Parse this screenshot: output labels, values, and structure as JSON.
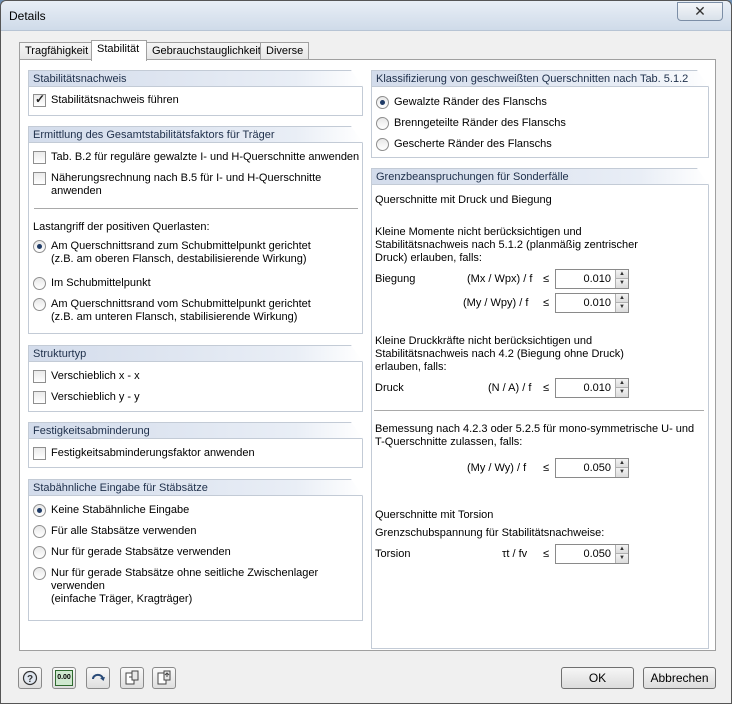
{
  "window": {
    "title": "Details",
    "close_glyph": "✕"
  },
  "tabs": [
    {
      "label": "Tragfähigkeit"
    },
    {
      "label": "Stabilität"
    },
    {
      "label": "Gebrauchstauglichkeit"
    },
    {
      "label": "Diverse"
    }
  ],
  "left": {
    "stab_nachweis": {
      "title": "Stabilitätsnachweis",
      "checkbox_label": "Stabilitätsnachweis führen",
      "checked": true
    },
    "ermittlung": {
      "title": "Ermittlung des Gesamtstabilitätsfaktors für Träger",
      "opt1": "Tab. B.2 für reguläre gewalzte I- und H-Querschnitte anwenden",
      "opt2_line1": "Näherungsrechnung nach B.5  für I- und H-Querschnitte",
      "opt2_line2": "anwenden",
      "lastangriff_label": "Lastangriff der positiven Querlasten:",
      "radio1_line1": "Am Querschnittsrand zum Schubmittelpunkt gerichtet",
      "radio1_line2": "(z.B. am oberen Flansch, destabilisierende Wirkung)",
      "radio2": "Im Schubmittelpunkt",
      "radio3_line1": "Am Querschnittsrand vom Schubmittelpunkt gerichtet",
      "radio3_line2": "(z.B. am unteren Flansch, stabilisierende Wirkung)"
    },
    "strukturtyp": {
      "title": "Strukturtyp",
      "opt1": "Verschieblich x - x",
      "opt2": "Verschieblich y - y"
    },
    "festigkeit": {
      "title": "Festigkeitsabminderung",
      "opt1": "Festigkeitsabminderungsfaktor anwenden"
    },
    "stabsatz": {
      "title": "Stabähnliche Eingabe für Stäbsätze",
      "r1": "Keine Stabähnliche Eingabe",
      "r2": "Für alle Stabsätze verwenden",
      "r3": "Nur für gerade Stabsätze verwenden",
      "r4_line1": "Nur für gerade Stabsätze ohne seitliche Zwischenlager verwenden",
      "r4_line2": "(einfache Träger, Kragträger)"
    }
  },
  "right": {
    "klass": {
      "title": "Klassifizierung von geschweißten Querschnitten nach Tab. 5.1.2",
      "r1": "Gewalzte Ränder des Flanschs",
      "r2": "Brenngeteilte Ränder des Flanschs",
      "r3": "Gescherte Ränder des Flanschs"
    },
    "grenz": {
      "title": "Grenzbeanspruchungen für Sonderfälle",
      "sub1": "Querschnitte mit Druck und Biegung",
      "p1_l1": "Kleine Momente nicht berücksichtigen und",
      "p1_l2": "Stabilitätsnachweis nach 5.1.2 (planmäßig zentrischer",
      "p1_l3": "Druck) erlauben, falls:",
      "biegung_label": "Biegung",
      "f1": "(Mx / Wpx) / f",
      "f2": "(My / Wpy) / f",
      "v1": "0.010",
      "v2": "0.010",
      "p2_l1": "Kleine Druckkräfte nicht berücksichtigen und",
      "p2_l2": "Stabilitätsnachweis nach 4.2 (Biegung ohne Druck)",
      "p2_l3": "erlauben, falls:",
      "druck_label": "Druck",
      "f3": "(N / A) / f",
      "v3": "0.010",
      "p3_l1": "Bemessung nach 4.2.3 oder 5.2.5 für mono-symmetrische U- und",
      "p3_l2": "T-Querschnitte zulassen, falls:",
      "f4": "(My / Wy) / f",
      "v4": "0.050",
      "sub2": "Querschnitte mit Torsion",
      "p4": "Grenzschubspannung für Stabilitätsnachweise:",
      "torsion_label": "Torsion",
      "f5": "τt / fv",
      "v5": "0.050",
      "le": "≤"
    }
  },
  "footer": {
    "ok": "OK",
    "cancel": "Abbrechen",
    "units_icon_text": "0.00"
  }
}
